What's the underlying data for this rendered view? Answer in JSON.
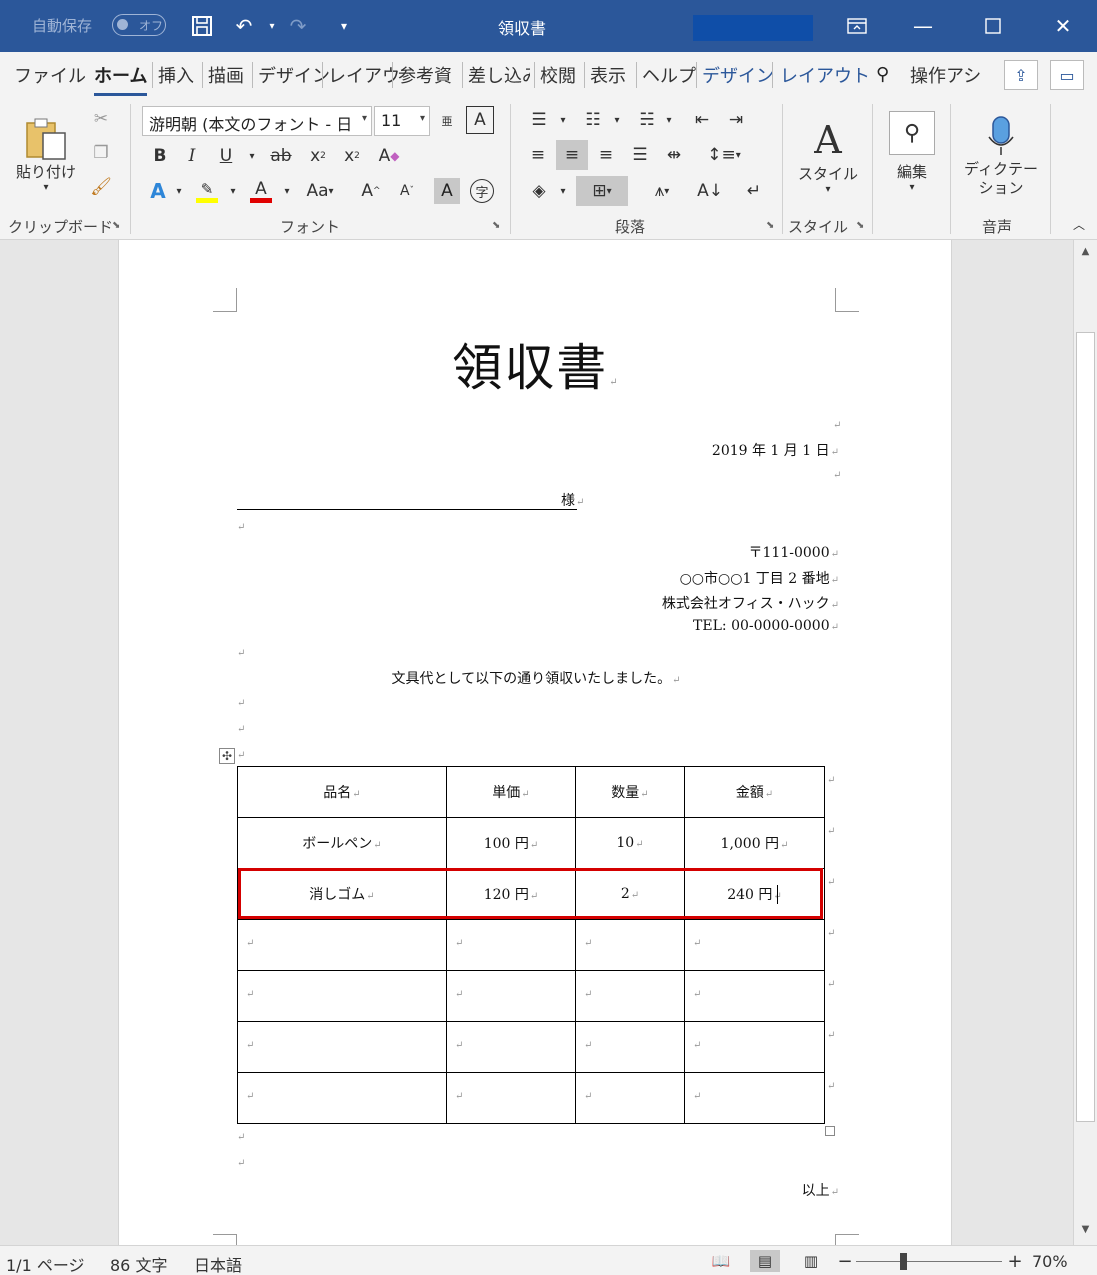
{
  "titlebar": {
    "autosave_label": "自動保存",
    "autosave_state": "オフ",
    "doc_title": "領収書",
    "save_icon": "save-icon",
    "undo_icon": "undo-icon",
    "redo_icon": "redo-icon",
    "restore_icon": "ribbon-display-icon"
  },
  "tabs": [
    {
      "label": "ファイル"
    },
    {
      "label": "ホーム"
    },
    {
      "label": "挿入"
    },
    {
      "label": "描画"
    },
    {
      "label": "デザイン"
    },
    {
      "label": "レイアウ"
    },
    {
      "label": "参考資"
    },
    {
      "label": "差し込み"
    },
    {
      "label": "校閲"
    },
    {
      "label": "表示"
    },
    {
      "label": "ヘルプ"
    },
    {
      "label": "デザイン"
    },
    {
      "label": "レイアウト"
    }
  ],
  "tell_me": "操作アシ",
  "ribbon": {
    "clipboard": {
      "label": "クリップボード",
      "paste": "貼り付け"
    },
    "font": {
      "label": "フォント",
      "font_name": "游明朝 (本文のフォント - 日",
      "font_size": "11",
      "ruby": "亜",
      "bold": "B",
      "italic": "I",
      "underline": "U",
      "strike": "ab",
      "sub": "x",
      "sup": "x",
      "aa": "Aa",
      "grow": "A",
      "shrink": "A",
      "char_shade": "A",
      "enclose": "字"
    },
    "paragraph": {
      "label": "段落"
    },
    "styles": {
      "label": "スタイル",
      "button": "スタイル"
    },
    "editing": {
      "button": "編集"
    },
    "voice": {
      "label": "音声",
      "button_line1": "ディクテー",
      "button_line2": "ション"
    }
  },
  "document": {
    "title": "領収書",
    "date": "2019 年 1 月 1 日",
    "honorific": "様",
    "postal": "〒111-0000",
    "address": "○○市○○1 丁目 2 番地",
    "company": "株式会社オフィス・ハック",
    "tel": "TEL: 00-0000-0000",
    "message": "文具代として以下の通り領収いたしました。",
    "closing": "以上",
    "table": {
      "headers": [
        "品名",
        "単価",
        "数量",
        "金額"
      ],
      "rows": [
        [
          "ボールペン",
          "100 円",
          "10",
          "1,000 円"
        ],
        [
          "消しゴム",
          "120 円",
          "2",
          "240 円"
        ],
        [
          "",
          "",
          "",
          ""
        ],
        [
          "",
          "",
          "",
          ""
        ],
        [
          "",
          "",
          "",
          ""
        ],
        [
          "",
          "",
          "",
          ""
        ]
      ]
    }
  },
  "statusbar": {
    "page": "1/1 ページ",
    "words": "86 文字",
    "language": "日本語",
    "zoom": "70%"
  },
  "colors": {
    "title_bar": "#2b579a",
    "selection_highlight": "#d40000"
  }
}
